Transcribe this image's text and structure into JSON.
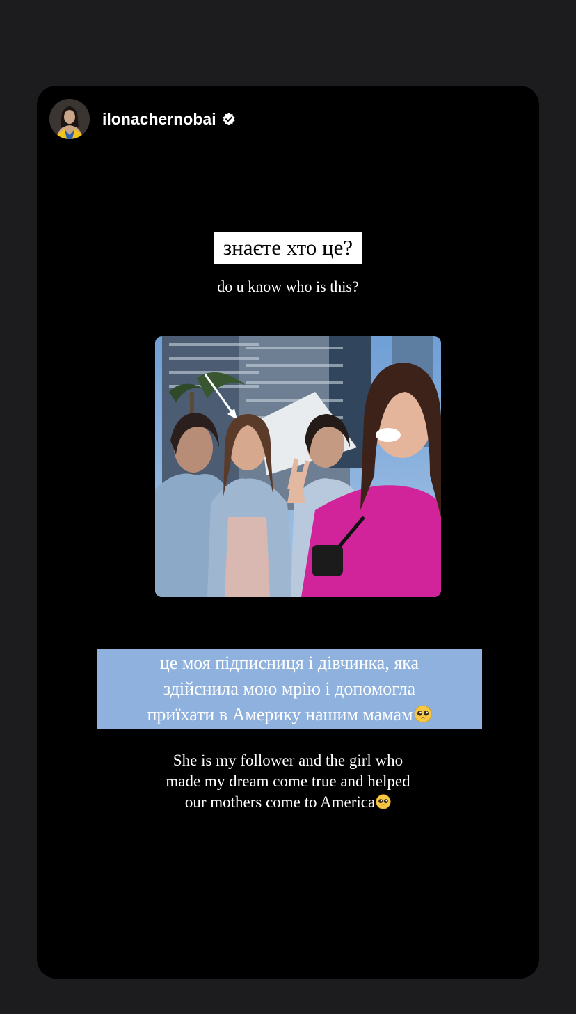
{
  "profile": {
    "username": "ilonachernobai",
    "verified_icon": "verified-badge-icon"
  },
  "story": {
    "headline": "знаєте хто це?",
    "subline": "do u know who is this?",
    "caption_ua": {
      "line1": "це моя підписниця і дівчинка, яка",
      "line2": "здійснила мою мрію і допомогла",
      "line3": "приїхати в Америку нашим мамам"
    },
    "caption_en": {
      "line1": "She is my follower and the girl who",
      "line2": "made my dream come true and helped",
      "line3": "our mothers come to America"
    },
    "emoji_icon": "pleading-face-emoji-icon"
  },
  "colors": {
    "background": "#1c1c1e",
    "story_bg": "#000000",
    "caption_highlight": "#8fb1dd"
  }
}
